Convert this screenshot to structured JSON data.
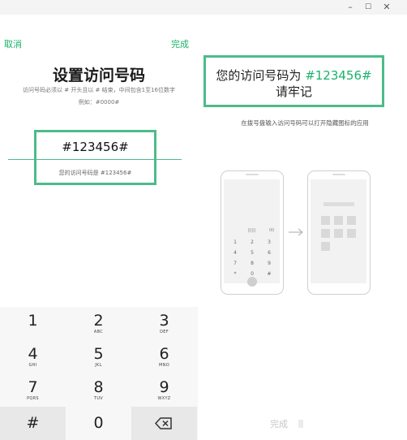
{
  "window": {
    "minimize_glyph": "–",
    "maximize_glyph": "☐",
    "close_glyph": "✕"
  },
  "header": {
    "cancel": "取消",
    "done": "完成"
  },
  "left": {
    "title": "设置访问号码",
    "desc_line1": "访问号码必须以 # 开头且以 # 结束，中间包含1至16位数字",
    "desc_line2": "例如：#0000#",
    "code_value": "#123456#",
    "code_hint": "您的访问号码是 #123456#"
  },
  "keypad": {
    "keys": [
      {
        "num": "1",
        "letters": ""
      },
      {
        "num": "2",
        "letters": "ABC"
      },
      {
        "num": "3",
        "letters": "DEF"
      },
      {
        "num": "4",
        "letters": "GHI"
      },
      {
        "num": "5",
        "letters": "JKL"
      },
      {
        "num": "6",
        "letters": "MNO"
      },
      {
        "num": "7",
        "letters": "PQRS"
      },
      {
        "num": "8",
        "letters": "TUV"
      },
      {
        "num": "9",
        "letters": "WXYZ"
      }
    ],
    "hash": "#",
    "zero": "0"
  },
  "right": {
    "banner_line1_prefix": "您的访问号码为 ",
    "banner_code": "#123456#",
    "banner_line2": "请牢记",
    "instruction": "在拨号盘输入访问号码可以打开隐藏图标的应用",
    "illustration": {
      "dial_display": "||||||",
      "dial_tail": "00",
      "keys": [
        "1",
        "2",
        "3",
        "4",
        "5",
        "6",
        "7",
        "8",
        "9",
        "*",
        "0",
        "#"
      ]
    },
    "bottom_done": "完成"
  }
}
